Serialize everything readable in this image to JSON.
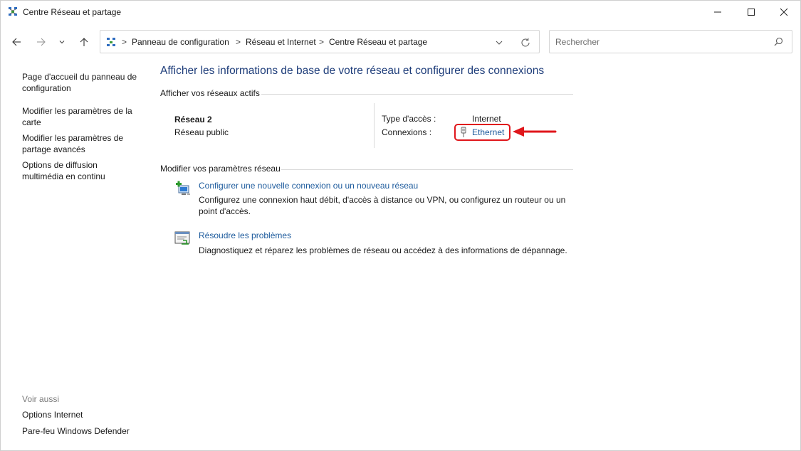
{
  "window": {
    "title": "Centre Réseau et partage",
    "minimize_icon": "minimize-icon",
    "maximize_icon": "maximize-icon",
    "close_icon": "close-icon"
  },
  "toolbar": {
    "back_icon": "arrow-left-icon",
    "forward_icon": "arrow-right-icon",
    "recent_icon": "chevron-down-icon",
    "up_icon": "arrow-up-icon",
    "breadcrumb": [
      "Panneau de configuration",
      "Réseau et Internet",
      "Centre Réseau et partage"
    ],
    "separator": ">",
    "search_placeholder": "Rechercher"
  },
  "sidebar": {
    "items": [
      "Page d'accueil du panneau de configuration",
      "Modifier les paramètres de la carte",
      "Modifier les paramètres de partage avancés",
      "Options de diffusion multimédia en continu"
    ],
    "see_also_label": "Voir aussi",
    "see_also_items": [
      "Options Internet",
      "Pare-feu Windows Defender"
    ]
  },
  "main": {
    "title": "Afficher les informations de base de votre réseau et configurer des connexions",
    "active_networks_label": "Afficher vos réseaux actifs",
    "network": {
      "name": "Réseau 2",
      "profile": "Réseau public",
      "access_type_label": "Type d'accès :",
      "access_type_value": "Internet",
      "connections_label": "Connexions :",
      "connection_name": "Ethernet"
    },
    "change_settings_label": "Modifier vos paramètres réseau",
    "tasks": [
      {
        "icon": "new-connection-icon",
        "link": "Configurer une nouvelle connexion ou un nouveau réseau",
        "description": "Configurez une connexion haut débit, d'accès à distance ou VPN, ou configurez un routeur ou un point d'accès."
      },
      {
        "icon": "troubleshoot-icon",
        "link": "Résoudre les problèmes",
        "description": "Diagnostiquez et réparez les problèmes de réseau ou accédez à des informations de dépannage."
      }
    ]
  },
  "colors": {
    "title_blue": "#1e3d7a",
    "link_blue": "#1c5a9c",
    "highlight_red": "#e0161b"
  }
}
